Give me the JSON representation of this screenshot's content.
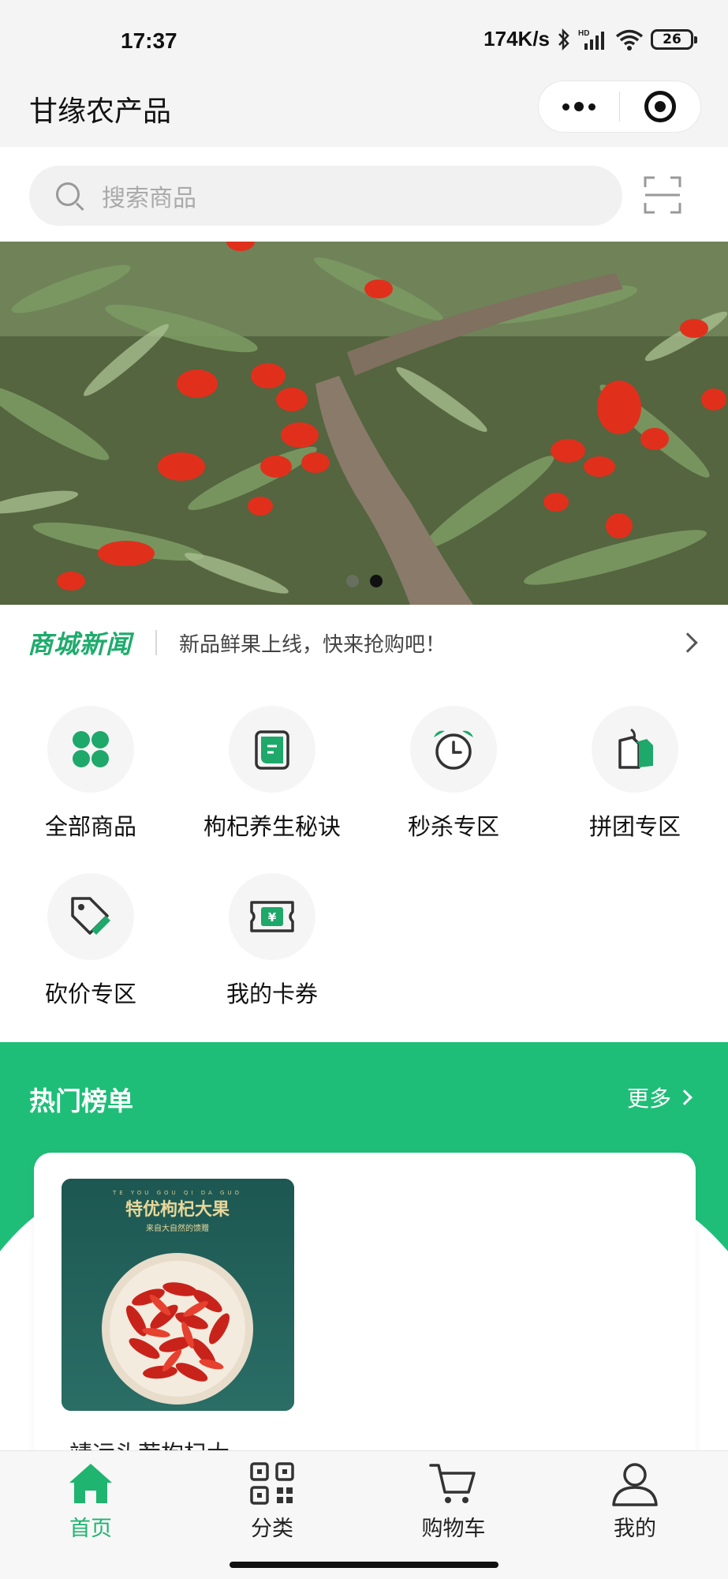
{
  "status_bar": {
    "time": "17:37",
    "network_speed": "174K/s",
    "battery": "26",
    "icons": [
      "bluetooth-icon",
      "signal-icon",
      "wifi-icon",
      "battery-icon"
    ]
  },
  "nav": {
    "title": "甘缘农产品",
    "more_icon": "more-dots-icon",
    "close_icon": "target-icon"
  },
  "search": {
    "placeholder": "搜索商品",
    "scan_icon": "scan-icon"
  },
  "banner": {
    "image": "goji-berry-bush-photo",
    "slide_count": 2,
    "active_index": 1
  },
  "news": {
    "label": "商城新闻",
    "text": "新品鲜果上线，快来抢购吧！"
  },
  "categories": [
    {
      "label": "全部商品",
      "icon": "clover-icon"
    },
    {
      "label": "枸杞养生秘诀",
      "icon": "book-icon"
    },
    {
      "label": "秒杀专区",
      "icon": "alarm-clock-icon"
    },
    {
      "label": "拼团专区",
      "icon": "tag-icon"
    },
    {
      "label": "砍价专区",
      "icon": "price-tag-cut-icon"
    },
    {
      "label": "我的卡券",
      "icon": "ticket-icon"
    }
  ],
  "hot": {
    "title": "热门榜单",
    "more": "更多",
    "products": [
      {
        "name": "靖远头茬枸杞大…",
        "image_title": "特优枸杞大果",
        "image_pinyin": "TE YOU GOU QI DA GUO",
        "image_subtitle": "来自大自然的馈赠"
      }
    ]
  },
  "tabs": [
    {
      "label": "首页",
      "icon": "home-icon",
      "active": true
    },
    {
      "label": "分类",
      "icon": "qr-grid-icon",
      "active": false
    },
    {
      "label": "购物车",
      "icon": "cart-icon",
      "active": false
    },
    {
      "label": "我的",
      "icon": "user-icon",
      "active": false
    }
  ],
  "colors": {
    "accent": "#1fbe78",
    "news_label": "#1eab6c",
    "active_tab": "#1fb46f"
  }
}
